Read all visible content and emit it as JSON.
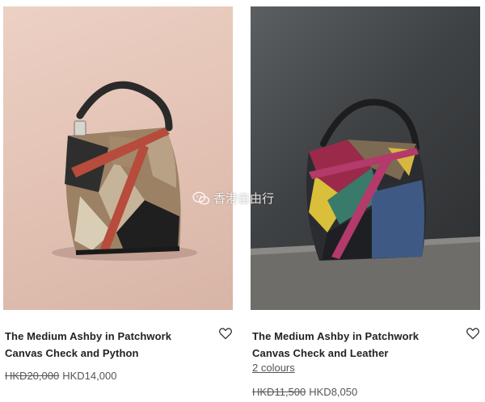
{
  "products": [
    {
      "title_line1": "The Medium Ashby in Patchwork",
      "title_line2": "Canvas Check and Python",
      "old_price": "HKD20,000",
      "new_price": "HKD14,000",
      "wishlist_icon": "heart-icon"
    },
    {
      "title_line1": "The Medium Ashby in Patchwork",
      "title_line2": "Canvas Check and Leather",
      "colours": "2 colours",
      "old_price": "HKD11,500",
      "new_price": "HKD8,050",
      "wishlist_icon": "heart-icon"
    }
  ],
  "watermark": {
    "text": "香港自由行",
    "icon": "wechat-icon"
  }
}
